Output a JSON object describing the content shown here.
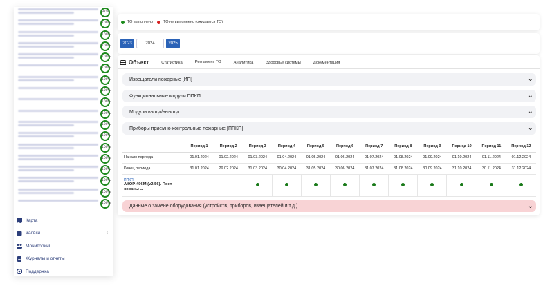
{
  "sidebar": {
    "objects": [
      {
        "badge": "97%",
        "lines": 2
      },
      {
        "badge": "100%",
        "lines": 2
      },
      {
        "badge": "100%",
        "lines": 2
      },
      {
        "badge": "100%",
        "lines": 2
      },
      {
        "badge": "100%",
        "lines": 2
      },
      {
        "badge": "100%",
        "lines": 1
      },
      {
        "badge": "100%",
        "lines": 2
      },
      {
        "badge": "100%",
        "lines": 1
      },
      {
        "badge": "100%",
        "lines": 1
      },
      {
        "badge": "100%",
        "lines": 1
      },
      {
        "badge": "100%",
        "lines": 2
      },
      {
        "badge": "100%",
        "lines": 2
      },
      {
        "badge": "100%",
        "lines": 2
      },
      {
        "badge": "100%",
        "lines": 2
      },
      {
        "badge": "100%",
        "lines": 2
      },
      {
        "badge": "100%",
        "lines": 2
      },
      {
        "badge": "100%",
        "lines": 2
      },
      {
        "badge": "100%",
        "lines": 1
      }
    ],
    "nav": [
      {
        "label": "Карта",
        "icon": "map-icon"
      },
      {
        "label": "Заявки",
        "icon": "requests-icon",
        "chevron": "‹"
      },
      {
        "label": "Мониторинг",
        "icon": "monitoring-icon"
      },
      {
        "label": "Журналы и отчеты",
        "icon": "journal-icon"
      },
      {
        "label": "Поддержка",
        "icon": "support-icon"
      }
    ]
  },
  "legend": {
    "done": "ТО выполнено",
    "not_done": "ТО не выполнено (ожидается ТО)",
    "done_color": "#1a8a1a",
    "not_done_color": "#d62020"
  },
  "years": [
    "2023",
    "2024",
    "2025"
  ],
  "tabs": {
    "object": "Объект",
    "stats": "Статистика",
    "regl": "Регламент ТО",
    "analytics": "Аналитика",
    "health": "Здоровье системы",
    "docs": "Документация"
  },
  "accordions": [
    "Извещатели пожарные [ИП]",
    "Функциональные модули ППКП",
    "Модули ввода/вывода",
    "Приборы приемно-контрольные пожарные [ППКП]"
  ],
  "table": {
    "periods": [
      "Период 1",
      "Период 2",
      "Период 3",
      "Период 4",
      "Период 5",
      "Период 6",
      "Период 7",
      "Период 8",
      "Период 9",
      "Период 10",
      "Период 11",
      "Период 12"
    ],
    "start_label": "Начало периода",
    "starts": [
      "01.01.2024",
      "01.02.2024",
      "01.03.2024",
      "01.04.2024",
      "01.05.2024",
      "01.06.2024",
      "01.07.2024",
      "01.08.2024",
      "01.09.2024",
      "01.10.2024",
      "01.11.2024",
      "01.12.2024"
    ],
    "end_label": "Конец периода",
    "ends": [
      "31.01.2024",
      "29.02.2024",
      "31.03.2024",
      "30.04.2024",
      "31.05.2024",
      "30.06.2024",
      "31.07.2024",
      "31.08.2024",
      "30.09.2024",
      "31.10.2024",
      "30.11.2024",
      "31.12.2024"
    ],
    "device_type": "ППКП",
    "device_name": "АКОР-496М (v2.56). Пост охраны ...",
    "statuses": [
      "none",
      "none",
      "done",
      "done",
      "done",
      "done",
      "done",
      "done",
      "done",
      "done",
      "done",
      "done"
    ]
  },
  "replace_section": "Данные о замене оборудования (устройств, приборов, извещателей и т.д.)",
  "chevron_glyph": "⌄"
}
